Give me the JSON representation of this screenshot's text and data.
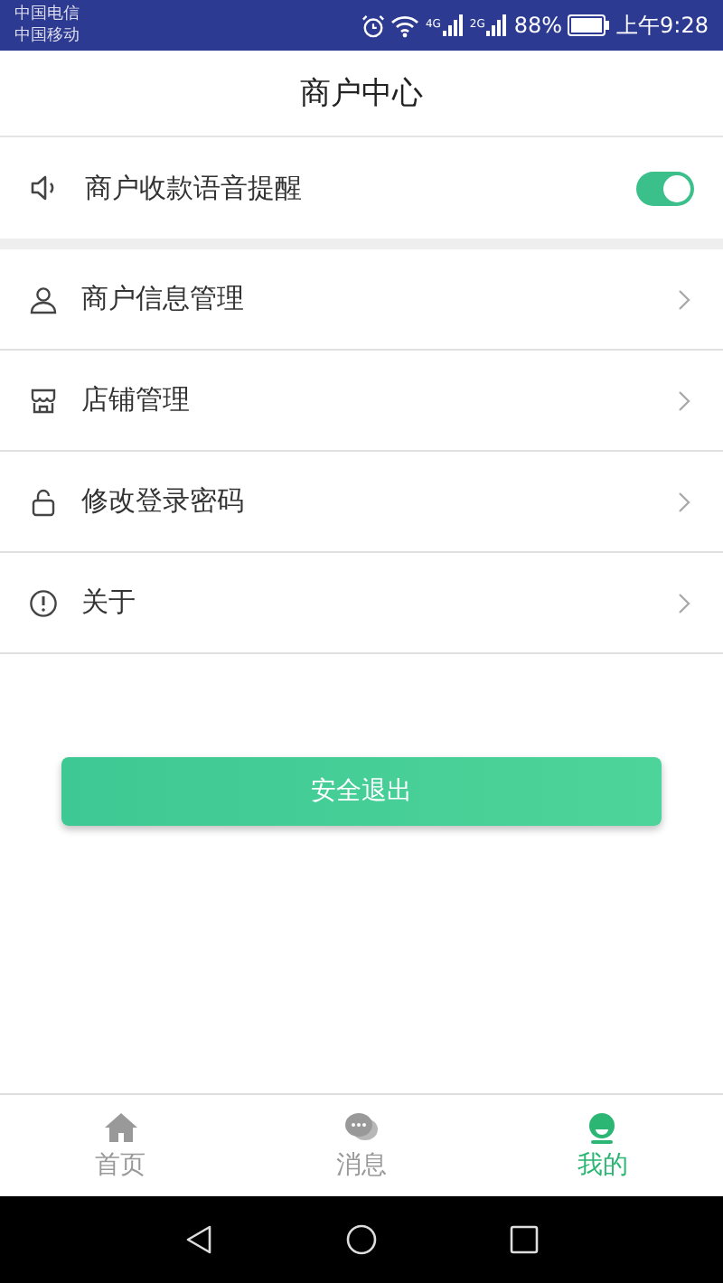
{
  "status_bar": {
    "carriers": [
      "中国电信",
      "中国移动"
    ],
    "network_1": "4G",
    "network_2": "2G",
    "battery": "88%",
    "time": "上午9:28"
  },
  "header": {
    "title": "商户中心"
  },
  "voice_setting": {
    "label": "商户收款语音提醒",
    "on": true
  },
  "menu": [
    {
      "kind": "person",
      "label": "商户信息管理"
    },
    {
      "kind": "store",
      "label": "店铺管理"
    },
    {
      "kind": "lock",
      "label": "修改登录密码"
    },
    {
      "kind": "info",
      "label": "关于"
    }
  ],
  "logout_button": "安全退出",
  "tab_bar": [
    {
      "kind": "home",
      "label": "首页",
      "selected": false
    },
    {
      "kind": "chat",
      "label": "消息",
      "selected": false
    },
    {
      "kind": "me",
      "label": "我的",
      "selected": true
    }
  ]
}
